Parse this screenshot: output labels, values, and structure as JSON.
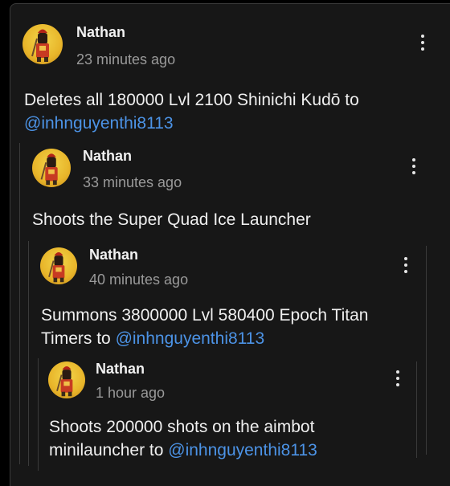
{
  "comments": [
    {
      "author": "Nathan",
      "time": "23 minutes ago",
      "body_line1": "Deletes all 180000 Lvl 2100 Shinichi Kudō to",
      "mention": "@inhnguyenthi8113"
    },
    {
      "author": "Nathan",
      "time": "33 minutes ago",
      "body_line1": "Shoots the Super Quad Ice Launcher"
    },
    {
      "author": "Nathan",
      "time": "40 minutes ago",
      "body_line1": "Summons 3800000 Lvl 580400 Epoch Titan",
      "body_line2": "Timers to ",
      "mention": "@inhnguyenthi8113"
    },
    {
      "author": "Nathan",
      "time": "1 hour ago",
      "body_line1": "Shoots 200000 shots on the aimbot",
      "body_line2": "minilauncher to ",
      "mention": "@inhnguyenthi8113"
    }
  ],
  "icons": {
    "more": "more-vert-icon",
    "avatar": "knight-avatar"
  },
  "colors": {
    "background": "#171717",
    "mention": "#4c93e6",
    "timestamp": "#9a9a9a"
  }
}
